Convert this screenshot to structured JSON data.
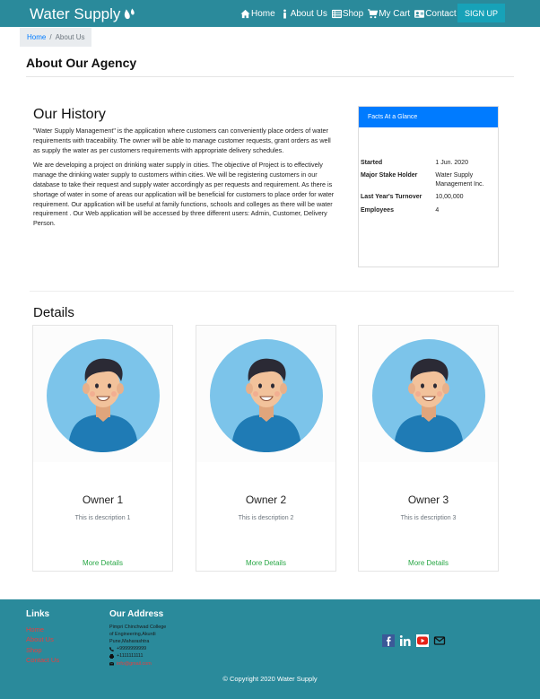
{
  "navbar": {
    "brand": "Water Supply",
    "links": [
      {
        "label": "Home",
        "icon": "home-icon"
      },
      {
        "label": "About Us",
        "icon": "info-icon"
      },
      {
        "label": "Shop",
        "icon": "list-icon"
      },
      {
        "label": "My Cart",
        "icon": "cart-icon"
      },
      {
        "label": "Contact Us",
        "icon": "contact-card-icon"
      }
    ],
    "signup_label": "SIGN UP"
  },
  "breadcrumb": {
    "home": "Home",
    "separator": "/",
    "current": "About Us"
  },
  "page_title": "About Our Agency",
  "history": {
    "title": "Our History",
    "paragraphs": [
      "\"Water Supply Management\" is the application where customers can conveniently place orders of water requirements with traceability. The owner will be able to manage customer requests, grant orders as well as supply the water as per customers requirements with appropriate delivery schedules.",
      "We are developing a project on drinking water supply in cities. The objective of Project is to effectively manage the drinking water supply to customers within cities. We will be registering customers in our database to take their request and supply water accordingly as per requests and requirement. As there is shortage of water in some of areas our application will be beneficial for customers to place order for water requirement. Our application will be useful at family functions, schools and colleges as there will be water requirement . Our Web application will be accessed by three different users: Admin, Customer, Delivery Person."
    ]
  },
  "facts": {
    "header": "Facts At a Glance",
    "rows": [
      {
        "key": "Started",
        "value": "1 Jun. 2020"
      },
      {
        "key": "Major Stake Holder",
        "value": "Water Supply Management Inc."
      },
      {
        "key": "Last Year's Turnover",
        "value": "10,00,000"
      },
      {
        "key": "Employees",
        "value": "4"
      }
    ]
  },
  "details": {
    "title": "Details",
    "owners": [
      {
        "name": "Owner 1",
        "description": "This is description 1",
        "more": "More Details"
      },
      {
        "name": "Owner 2",
        "description": "This is description 2",
        "more": "More Details"
      },
      {
        "name": "Owner 3",
        "description": "This is description 3",
        "more": "More Details"
      }
    ]
  },
  "footer": {
    "links_title": "Links",
    "links": [
      "Home",
      "About Us",
      "Shop",
      "Contact Us"
    ],
    "address_title": "Our Address",
    "address_lines": [
      "Pimpri Chinchwad College",
      "of Engineering,Akurdi",
      "Pune,Maharashtra"
    ],
    "phone": "+9999999999",
    "fax": "+1111111111",
    "email": "info@gmail.com",
    "socials": [
      "facebook-icon",
      "linkedin-icon",
      "youtube-icon",
      "mail-icon"
    ],
    "copyright": "© Copyright 2020 Water Supply"
  },
  "colors": {
    "nav_bg": "#2a8a9b",
    "signup_bg": "#17a2b8",
    "facts_header": "#007bff",
    "link_green": "#28a745",
    "footer_link": "#e83e3e"
  }
}
